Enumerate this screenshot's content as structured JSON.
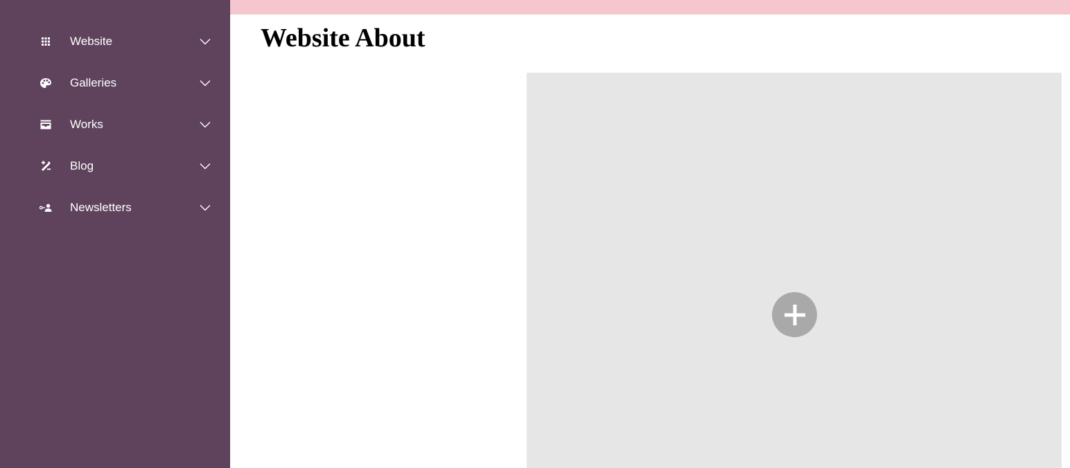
{
  "colors": {
    "sidebar_bg": "#5f435d",
    "topbar_bg": "#f5c6ce",
    "placeholder_bg": "#e6e6e6",
    "add_button_bg": "#a9a9a9"
  },
  "sidebar": {
    "items": [
      {
        "label": "Website",
        "icon": "grid-icon"
      },
      {
        "label": "Galleries",
        "icon": "palette-icon"
      },
      {
        "label": "Works",
        "icon": "inbox-image-icon"
      },
      {
        "label": "Blog",
        "icon": "edit-tools-icon"
      },
      {
        "label": "Newsletters",
        "icon": "person-key-icon"
      }
    ]
  },
  "main": {
    "title": "Website About",
    "placeholder": {
      "add_icon": "plus-icon"
    }
  }
}
